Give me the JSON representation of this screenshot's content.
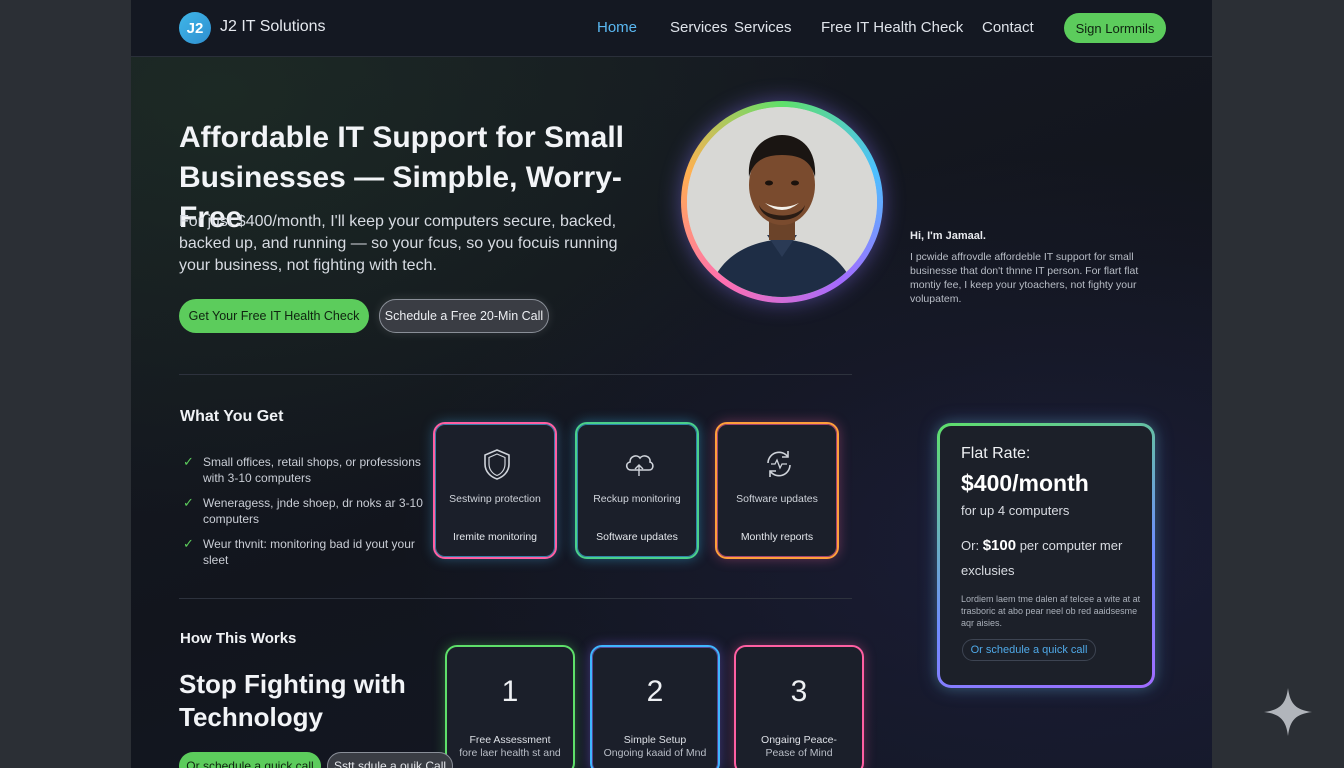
{
  "nav": {
    "logo_badge": "J2",
    "brand": "J2 IT Solutions",
    "links": [
      "Home",
      "Services",
      "Services",
      "Free IT Health Check",
      "Contact"
    ],
    "cta": "Sign Lormnils"
  },
  "hero": {
    "title": "Affordable IT Support for Small Businesses — Simpble, Worry-Free",
    "subtitle": "For just $400/month, I'll keep your computers secure,   backed, backed up, and running — so your fcus, so you focuis running your business, not fighting with tech.",
    "primary_button": "Get Your Free IT Health Check",
    "secondary_button": "Schedule a Free 20-Min Call"
  },
  "intro": {
    "greeting": "Hi, I'm Jamaal.",
    "text": "I pcwide affrovdle affordeble IT support for small businesse that don't thnne IT person. For flart flat montiy fee, I keep your ytoachers, not fighty your volupatem."
  },
  "what_you_get": {
    "heading": "What You Get",
    "items": [
      "Small offices, retail shops, or professions with 3-10 computers",
      "Weneragess, jnde shoep, dr noks ar 3-10 computers",
      "Weur thvnit: monitoring bad id yout your sleet"
    ],
    "features": [
      {
        "icon": "shield-icon",
        "title": "Sestwinp protection",
        "caption": "Iremite monitoring"
      },
      {
        "icon": "cloud-icon",
        "title": "Reckup monitoring",
        "caption": "Software updates"
      },
      {
        "icon": "refresh-icon",
        "title": "Software updates",
        "caption": "Monthly reports"
      }
    ]
  },
  "how": {
    "heading": "How This Works",
    "title": "Stop Fighting with Technology",
    "steps": [
      {
        "num": "1",
        "title": "Free Assessment",
        "sub": "fore laer health st and"
      },
      {
        "num": "2",
        "title": "Simple Setup",
        "sub": "Ongoing kaaid of Mnd"
      },
      {
        "num": "3",
        "title": "Ongaing Peace-",
        "sub": "Pease of Mind"
      }
    ],
    "button_primary": "Or schedule a quick call",
    "button_secondary": "Sstt sdule a ouik Call"
  },
  "pricing": {
    "label": "Flat Rate:",
    "price": "$400/month",
    "sub": "for up 4 computers",
    "alt_prefix": "Or:",
    "alt_price": "$100",
    "alt_suffix": "per computer mer exclusies",
    "note": "Lordiem laem tme dalen af telcee a wite at at trasboric at abo pear neel ob red aaidsesme aqr aisies.",
    "link": "Or schedule a quick call"
  },
  "colors": {
    "accent_green": "#5ccc5c",
    "accent_blue": "#5ab8f2",
    "background": "#12151d"
  }
}
